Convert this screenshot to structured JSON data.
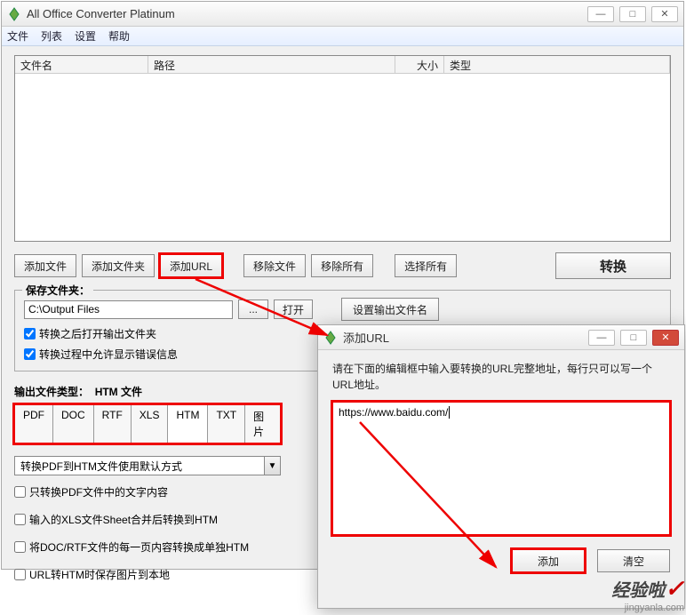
{
  "main": {
    "title": "All Office Converter Platinum",
    "menu": {
      "file": "文件",
      "list": "列表",
      "settings": "设置",
      "help": "帮助"
    },
    "columns": {
      "filename": "文件名",
      "path": "路径",
      "size": "大小",
      "type": "类型"
    },
    "buttons": {
      "addFile": "添加文件",
      "addFolder": "添加文件夹",
      "addURL": "添加URL",
      "removeFile": "移除文件",
      "removeAll": "移除所有",
      "selectAll": "选择所有",
      "convert": "转换"
    },
    "saveGroup": {
      "legend": "保存文件夹：",
      "path": "C:\\Output Files",
      "browse": "...",
      "open": "打开",
      "setName": "设置输出文件名",
      "chkOpen": "转换之后打开输出文件夹",
      "chkErr": "转换过程中允许显示错误信息"
    },
    "outType": {
      "label": "输出文件类型：",
      "current": "HTM 文件",
      "tabs": [
        "PDF",
        "DOC",
        "RTF",
        "XLS",
        "HTM",
        "TXT",
        "图片"
      ],
      "dropdown": "转换PDF到HTM文件使用默认方式",
      "opts": [
        "只转换PDF文件中的文字内容",
        "输入的XLS文件Sheet合并后转换到HTM",
        "将DOC/RTF文件的每一页内容转换成单独HTM",
        "URL转HTM时保存图片到本地"
      ]
    }
  },
  "dialog": {
    "title": "添加URL",
    "instruction": "请在下面的编辑框中输入要转换的URL完整地址，每行只可以写一个URL地址。",
    "url": "https://www.baidu.com/",
    "add": "添加",
    "clear": "清空"
  },
  "watermark": {
    "big": "经验啦",
    "url": "jingyanla.com"
  }
}
